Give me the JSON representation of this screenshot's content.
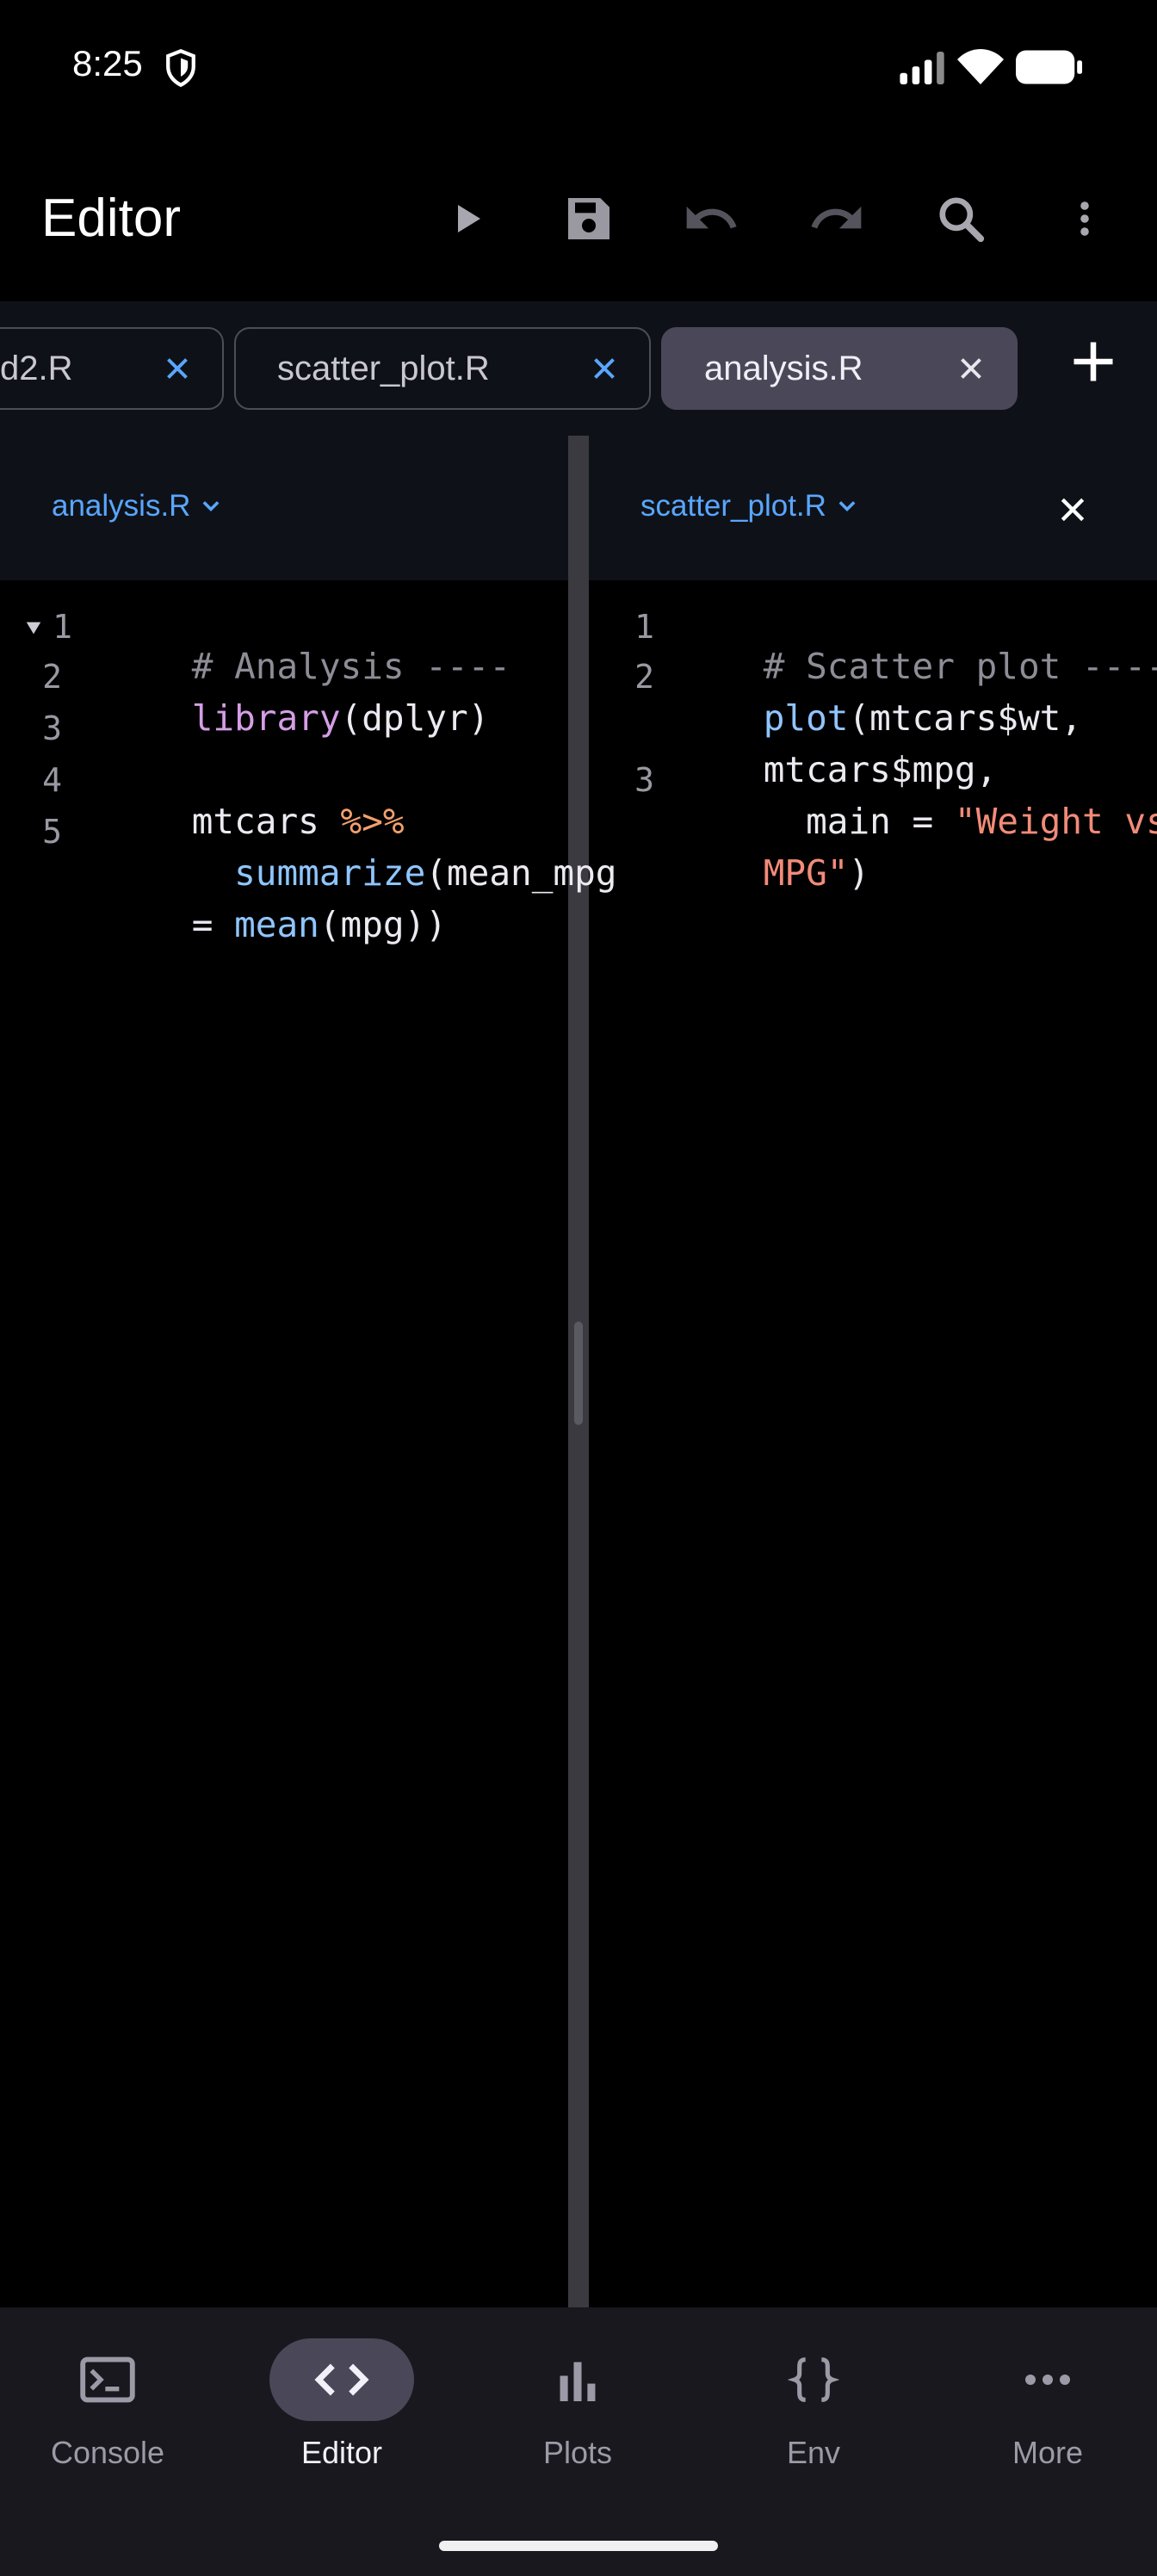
{
  "status": {
    "time": "8:25"
  },
  "appbar": {
    "title": "Editor"
  },
  "tabs": [
    {
      "label": "d2.R",
      "active": false
    },
    {
      "label": "scatter_plot.R",
      "active": false
    },
    {
      "label": "analysis.R",
      "active": true
    }
  ],
  "panes": {
    "left": {
      "file": "analysis.R"
    },
    "right": {
      "file": "scatter_plot.R"
    }
  },
  "left_code": {
    "ln1": "1",
    "ln2": "2",
    "ln3": "3",
    "ln4": "4",
    "ln5": "5",
    "l1": "# Analysis ----",
    "l2a": "library",
    "l2b": "(dplyr)",
    "l4a": "mtcars ",
    "l4b": "%>%",
    "l5a": "  summarize",
    "l5b": "(mean_mpg",
    "l5c": "= ",
    "l5d": "mean",
    "l5e": "(mpg))"
  },
  "right_code": {
    "ln1": "1",
    "ln2": "2",
    "ln3": "3",
    "l1": "# Scatter plot ----",
    "l2a": "plot",
    "l2b": "(mtcars$wt,",
    "l2c": "mtcars$mpg,",
    "l3a": "  main = ",
    "l3b": "\"Weight vs",
    "l3c": "MPG\"",
    "l3d": ")"
  },
  "nav": [
    {
      "label": "Console",
      "icon": "terminal-icon"
    },
    {
      "label": "Editor",
      "icon": "code-icon",
      "active": true
    },
    {
      "label": "Plots",
      "icon": "bar-chart-icon"
    },
    {
      "label": "Env",
      "icon": "braces-icon"
    },
    {
      "label": "More",
      "icon": "more-horiz-icon"
    }
  ],
  "colors": {
    "accent": "#5aa6ff",
    "comment": "#8e8c96",
    "keyword_fn": "#d59ee6",
    "builtin_fn": "#8fc5ff",
    "operator": "#f2a06d",
    "string": "#f28b7a",
    "active_tab": "#4a4858"
  }
}
